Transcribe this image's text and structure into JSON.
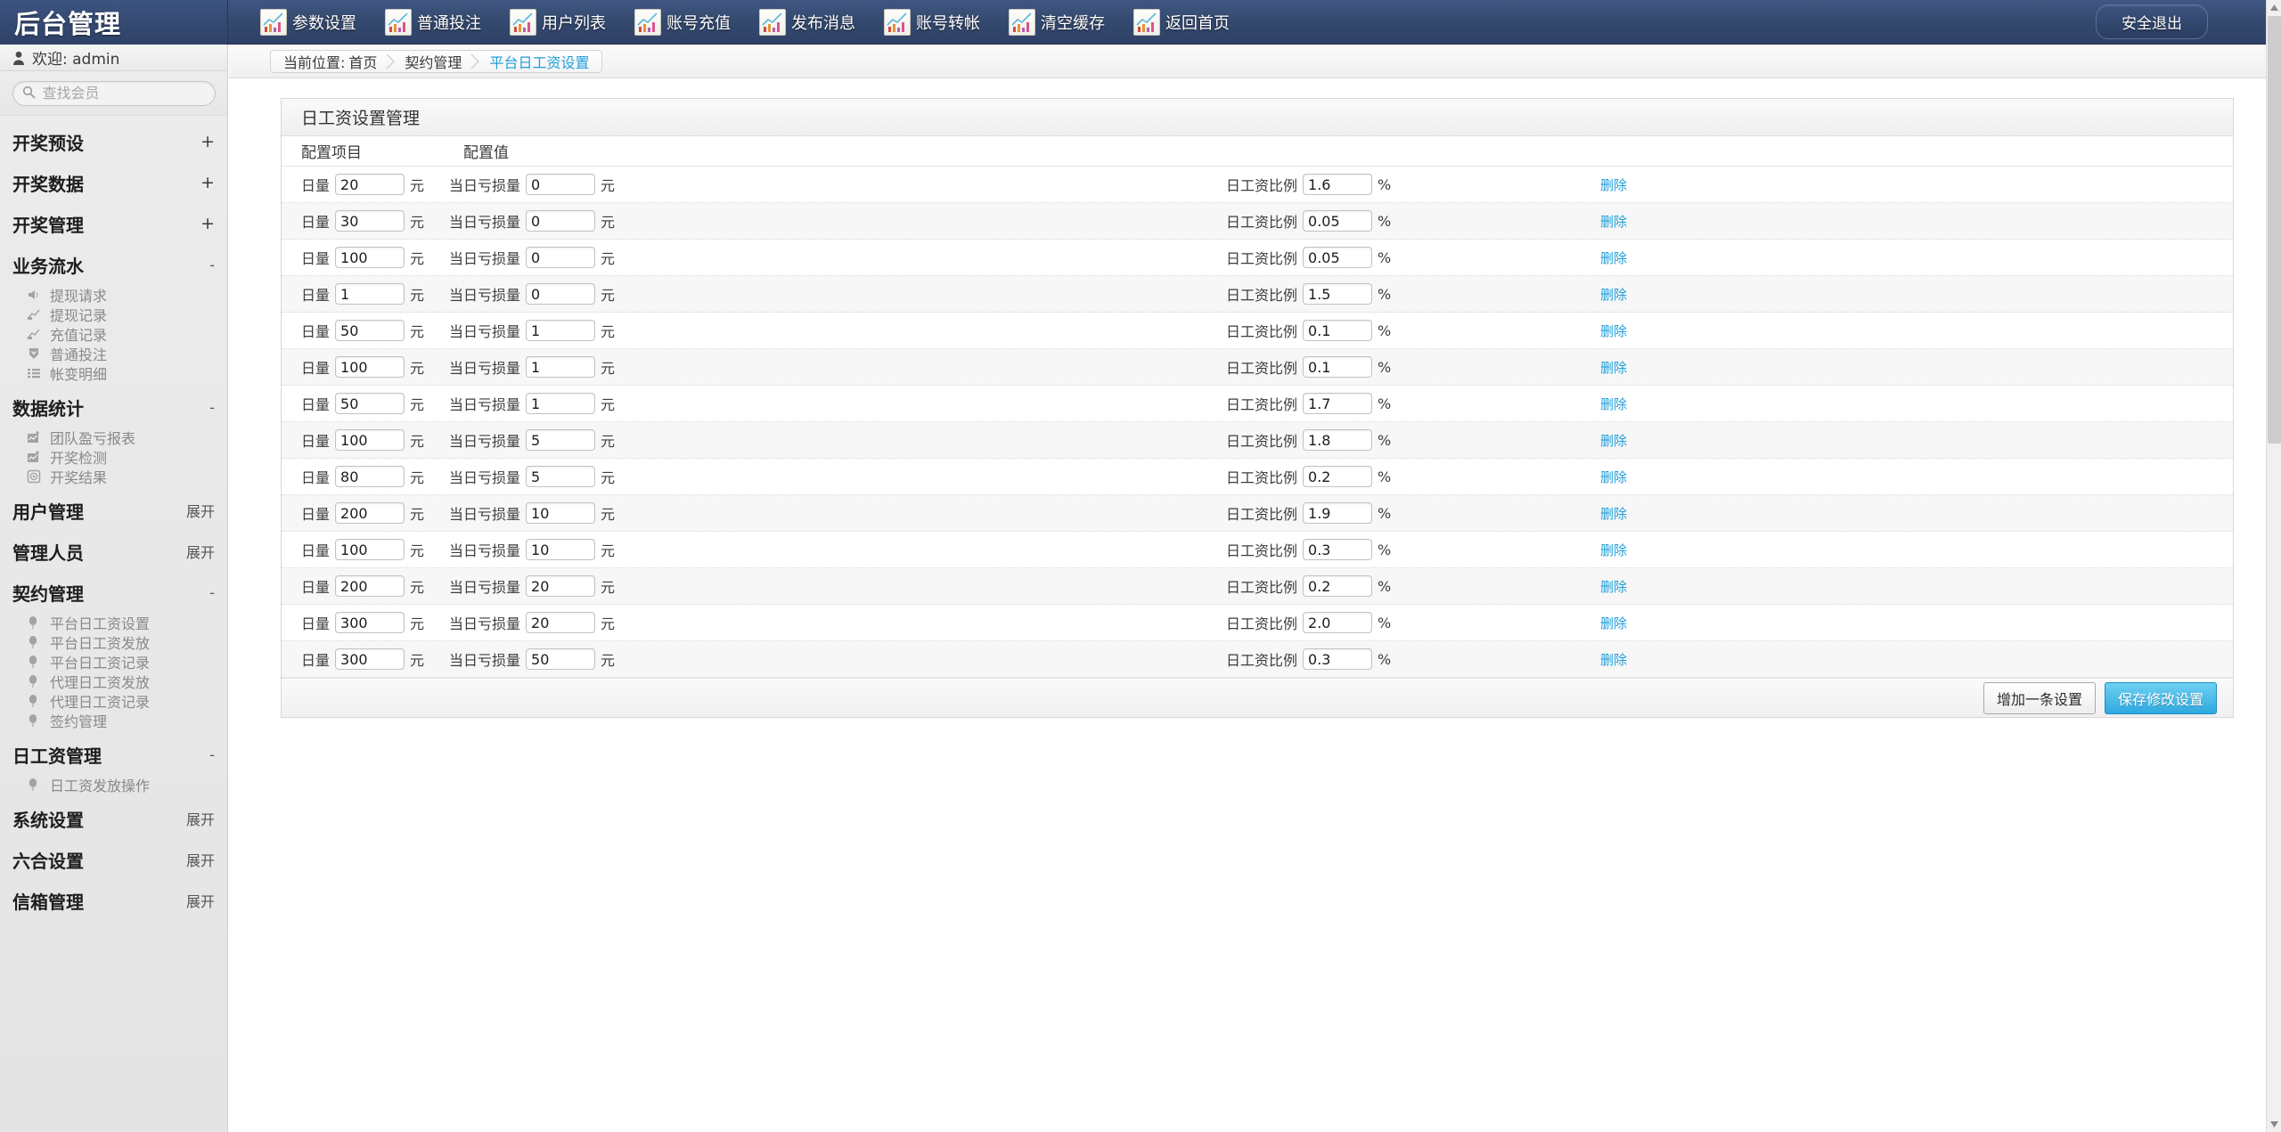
{
  "brand": {
    "title": "后台管理"
  },
  "topnav": {
    "items": [
      {
        "label": "参数设置",
        "icon": "chart-icon"
      },
      {
        "label": "普通投注",
        "icon": "chart-icon"
      },
      {
        "label": "用户列表",
        "icon": "chart-icon"
      },
      {
        "label": "账号充值",
        "icon": "chart-icon"
      },
      {
        "label": "发布消息",
        "icon": "chart-icon"
      },
      {
        "label": "账号转帐",
        "icon": "chart-icon"
      },
      {
        "label": "清空缓存",
        "icon": "chart-icon"
      },
      {
        "label": "返回首页",
        "icon": "chart-icon"
      }
    ],
    "logout_label": "安全退出"
  },
  "sidebar": {
    "welcome": "欢迎: admin",
    "search_placeholder": "查找会员",
    "groups": [
      {
        "label": "开奖预设",
        "state": "+",
        "items": []
      },
      {
        "label": "开奖数据",
        "state": "+",
        "items": []
      },
      {
        "label": "开奖管理",
        "state": "+",
        "items": []
      },
      {
        "label": "业务流水",
        "state": "-",
        "items": [
          {
            "label": "提现请求",
            "icon": "speaker-icon"
          },
          {
            "label": "提现记录",
            "icon": "trend-up-icon"
          },
          {
            "label": "充值记录",
            "icon": "trend-up-icon"
          },
          {
            "label": "普通投注",
            "icon": "shield-down-icon"
          },
          {
            "label": "帐变明细",
            "icon": "list-icon"
          }
        ]
      },
      {
        "label": "数据统计",
        "state": "-",
        "items": [
          {
            "label": "团队盈亏报表",
            "icon": "chart-add-icon"
          },
          {
            "label": "开奖检测",
            "icon": "chart-add-icon"
          },
          {
            "label": "开奖结果",
            "icon": "target-icon"
          }
        ]
      },
      {
        "label": "用户管理",
        "state": "展开",
        "items": []
      },
      {
        "label": "管理人员",
        "state": "展开",
        "items": []
      },
      {
        "label": "契约管理",
        "state": "-",
        "items": [
          {
            "label": "平台日工资设置",
            "icon": "balloon-icon"
          },
          {
            "label": "平台日工资发放",
            "icon": "balloon-icon"
          },
          {
            "label": "平台日工资记录",
            "icon": "balloon-icon"
          },
          {
            "label": "代理日工资发放",
            "icon": "balloon-icon"
          },
          {
            "label": "代理日工资记录",
            "icon": "balloon-icon"
          },
          {
            "label": "签约管理",
            "icon": "balloon-icon"
          }
        ]
      },
      {
        "label": "日工资管理",
        "state": "-",
        "items": [
          {
            "label": "日工资发放操作",
            "icon": "balloon-icon"
          }
        ]
      },
      {
        "label": "系统设置",
        "state": "展开",
        "items": []
      },
      {
        "label": "六合设置",
        "state": "展开",
        "items": []
      },
      {
        "label": "信箱管理",
        "state": "展开",
        "items": []
      }
    ]
  },
  "breadcrumb": {
    "prefix": "当前位置:",
    "crumbs": [
      "首页",
      "契约管理",
      "平台日工资设置"
    ],
    "active_index": 2
  },
  "panel": {
    "title": "日工资设置管理",
    "columns": [
      "配置项目",
      "配置值"
    ],
    "labels": {
      "volume": "日量",
      "loss": "当日亏损量",
      "ratio": "日工资比例",
      "unit_yuan": "元",
      "unit_percent": "%",
      "delete": "删除"
    },
    "rows": [
      {
        "volume": "20",
        "loss": "0",
        "ratio": "1.6"
      },
      {
        "volume": "30",
        "loss": "0",
        "ratio": "0.05"
      },
      {
        "volume": "100",
        "loss": "0",
        "ratio": "0.05"
      },
      {
        "volume": "1",
        "loss": "0",
        "ratio": "1.5"
      },
      {
        "volume": "50",
        "loss": "1",
        "ratio": "0.1"
      },
      {
        "volume": "100",
        "loss": "1",
        "ratio": "0.1"
      },
      {
        "volume": "50",
        "loss": "1",
        "ratio": "1.7"
      },
      {
        "volume": "100",
        "loss": "5",
        "ratio": "1.8"
      },
      {
        "volume": "80",
        "loss": "5",
        "ratio": "0.2"
      },
      {
        "volume": "200",
        "loss": "10",
        "ratio": "1.9"
      },
      {
        "volume": "100",
        "loss": "10",
        "ratio": "0.3"
      },
      {
        "volume": "200",
        "loss": "20",
        "ratio": "0.2"
      },
      {
        "volume": "300",
        "loss": "20",
        "ratio": "2.0"
      },
      {
        "volume": "300",
        "loss": "50",
        "ratio": "0.3"
      }
    ],
    "footer": {
      "add_label": "增加一条设置",
      "save_label": "保存修改设置"
    }
  },
  "colors": {
    "topbar": "#34496e",
    "accent": "#1f9ed9",
    "primary_button": "#2ea9e0"
  }
}
